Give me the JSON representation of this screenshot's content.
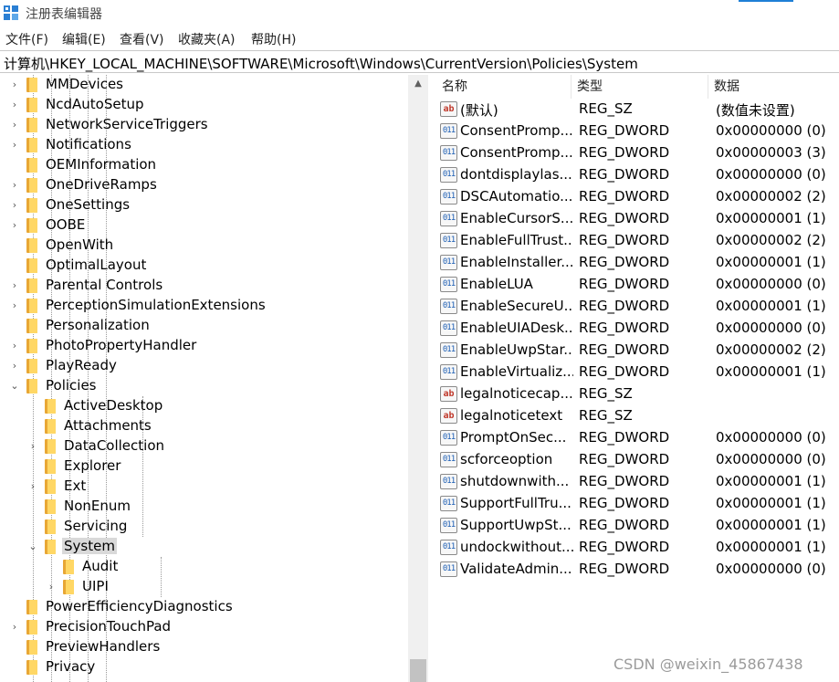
{
  "window": {
    "title": "注册表编辑器",
    "icon": "regedit-icon",
    "accent_color": "#1e7fd6"
  },
  "menu": [
    "文件(F)",
    "编辑(E)",
    "查看(V)",
    "收藏夹(A)",
    "帮助(H)"
  ],
  "address": "计算机\\HKEY_LOCAL_MACHINE\\SOFTWARE\\Microsoft\\Windows\\CurrentVersion\\Policies\\System",
  "tree": [
    {
      "label": "MMDevices",
      "expander": "›"
    },
    {
      "label": "NcdAutoSetup",
      "expander": "›"
    },
    {
      "label": "NetworkServiceTriggers",
      "expander": "›"
    },
    {
      "label": "Notifications",
      "expander": "›"
    },
    {
      "label": "OEMInformation",
      "expander": ""
    },
    {
      "label": "OneDriveRamps",
      "expander": "›"
    },
    {
      "label": "OneSettings",
      "expander": "›"
    },
    {
      "label": "OOBE",
      "expander": "›"
    },
    {
      "label": "OpenWith",
      "expander": ""
    },
    {
      "label": "OptimalLayout",
      "expander": ""
    },
    {
      "label": "Parental Controls",
      "expander": "›"
    },
    {
      "label": "PerceptionSimulationExtensions",
      "expander": "›"
    },
    {
      "label": "Personalization",
      "expander": ""
    },
    {
      "label": "PhotoPropertyHandler",
      "expander": "›"
    },
    {
      "label": "PlayReady",
      "expander": "›"
    },
    {
      "label": "Policies",
      "expander": "⌄"
    },
    {
      "label": "ActiveDesktop",
      "expander": ""
    },
    {
      "label": "Attachments",
      "expander": ""
    },
    {
      "label": "DataCollection",
      "expander": "›"
    },
    {
      "label": "Explorer",
      "expander": ""
    },
    {
      "label": "Ext",
      "expander": "›"
    },
    {
      "label": "NonEnum",
      "expander": ""
    },
    {
      "label": "Servicing",
      "expander": ""
    },
    {
      "label": "System",
      "expander": "⌄"
    },
    {
      "label": "Audit",
      "expander": ""
    },
    {
      "label": "UIPI",
      "expander": "›"
    },
    {
      "label": "PowerEfficiencyDiagnostics",
      "expander": ""
    },
    {
      "label": "PrecisionTouchPad",
      "expander": "›"
    },
    {
      "label": "PreviewHandlers",
      "expander": ""
    },
    {
      "label": "Privacy",
      "expander": ""
    }
  ],
  "columns": {
    "name": "名称",
    "type": "类型",
    "data": "数据"
  },
  "values": [
    {
      "icon": "ab",
      "name": "(默认)",
      "type": "REG_SZ",
      "data": "(数值未设置)"
    },
    {
      "icon": "011",
      "name": "ConsentPromp...",
      "type": "REG_DWORD",
      "data": "0x00000000 (0)"
    },
    {
      "icon": "011",
      "name": "ConsentPromp...",
      "type": "REG_DWORD",
      "data": "0x00000003 (3)"
    },
    {
      "icon": "011",
      "name": "dontdisplaylas...",
      "type": "REG_DWORD",
      "data": "0x00000000 (0)"
    },
    {
      "icon": "011",
      "name": "DSCAutomatio...",
      "type": "REG_DWORD",
      "data": "0x00000002 (2)"
    },
    {
      "icon": "011",
      "name": "EnableCursorS...",
      "type": "REG_DWORD",
      "data": "0x00000001 (1)"
    },
    {
      "icon": "011",
      "name": "EnableFullTrust...",
      "type": "REG_DWORD",
      "data": "0x00000002 (2)"
    },
    {
      "icon": "011",
      "name": "EnableInstaller...",
      "type": "REG_DWORD",
      "data": "0x00000001 (1)"
    },
    {
      "icon": "011",
      "name": "EnableLUA",
      "type": "REG_DWORD",
      "data": "0x00000000 (0)"
    },
    {
      "icon": "011",
      "name": "EnableSecureU...",
      "type": "REG_DWORD",
      "data": "0x00000001 (1)"
    },
    {
      "icon": "011",
      "name": "EnableUIADesk...",
      "type": "REG_DWORD",
      "data": "0x00000000 (0)"
    },
    {
      "icon": "011",
      "name": "EnableUwpStar...",
      "type": "REG_DWORD",
      "data": "0x00000002 (2)"
    },
    {
      "icon": "011",
      "name": "EnableVirtualiz...",
      "type": "REG_DWORD",
      "data": "0x00000001 (1)"
    },
    {
      "icon": "ab",
      "name": "legalnoticecap...",
      "type": "REG_SZ",
      "data": ""
    },
    {
      "icon": "ab",
      "name": "legalnoticetext",
      "type": "REG_SZ",
      "data": ""
    },
    {
      "icon": "011",
      "name": "PromptOnSec...",
      "type": "REG_DWORD",
      "data": "0x00000000 (0)"
    },
    {
      "icon": "011",
      "name": "scforceoption",
      "type": "REG_DWORD",
      "data": "0x00000000 (0)"
    },
    {
      "icon": "011",
      "name": "shutdownwith...",
      "type": "REG_DWORD",
      "data": "0x00000001 (1)"
    },
    {
      "icon": "011",
      "name": "SupportFullTru...",
      "type": "REG_DWORD",
      "data": "0x00000001 (1)"
    },
    {
      "icon": "011",
      "name": "SupportUwpSt...",
      "type": "REG_DWORD",
      "data": "0x00000001 (1)"
    },
    {
      "icon": "011",
      "name": "undockwithout...",
      "type": "REG_DWORD",
      "data": "0x00000001 (1)"
    },
    {
      "icon": "011",
      "name": "ValidateAdmin...",
      "type": "REG_DWORD",
      "data": "0x00000000 (0)"
    }
  ],
  "watermark": "CSDN @weixin_45867438"
}
